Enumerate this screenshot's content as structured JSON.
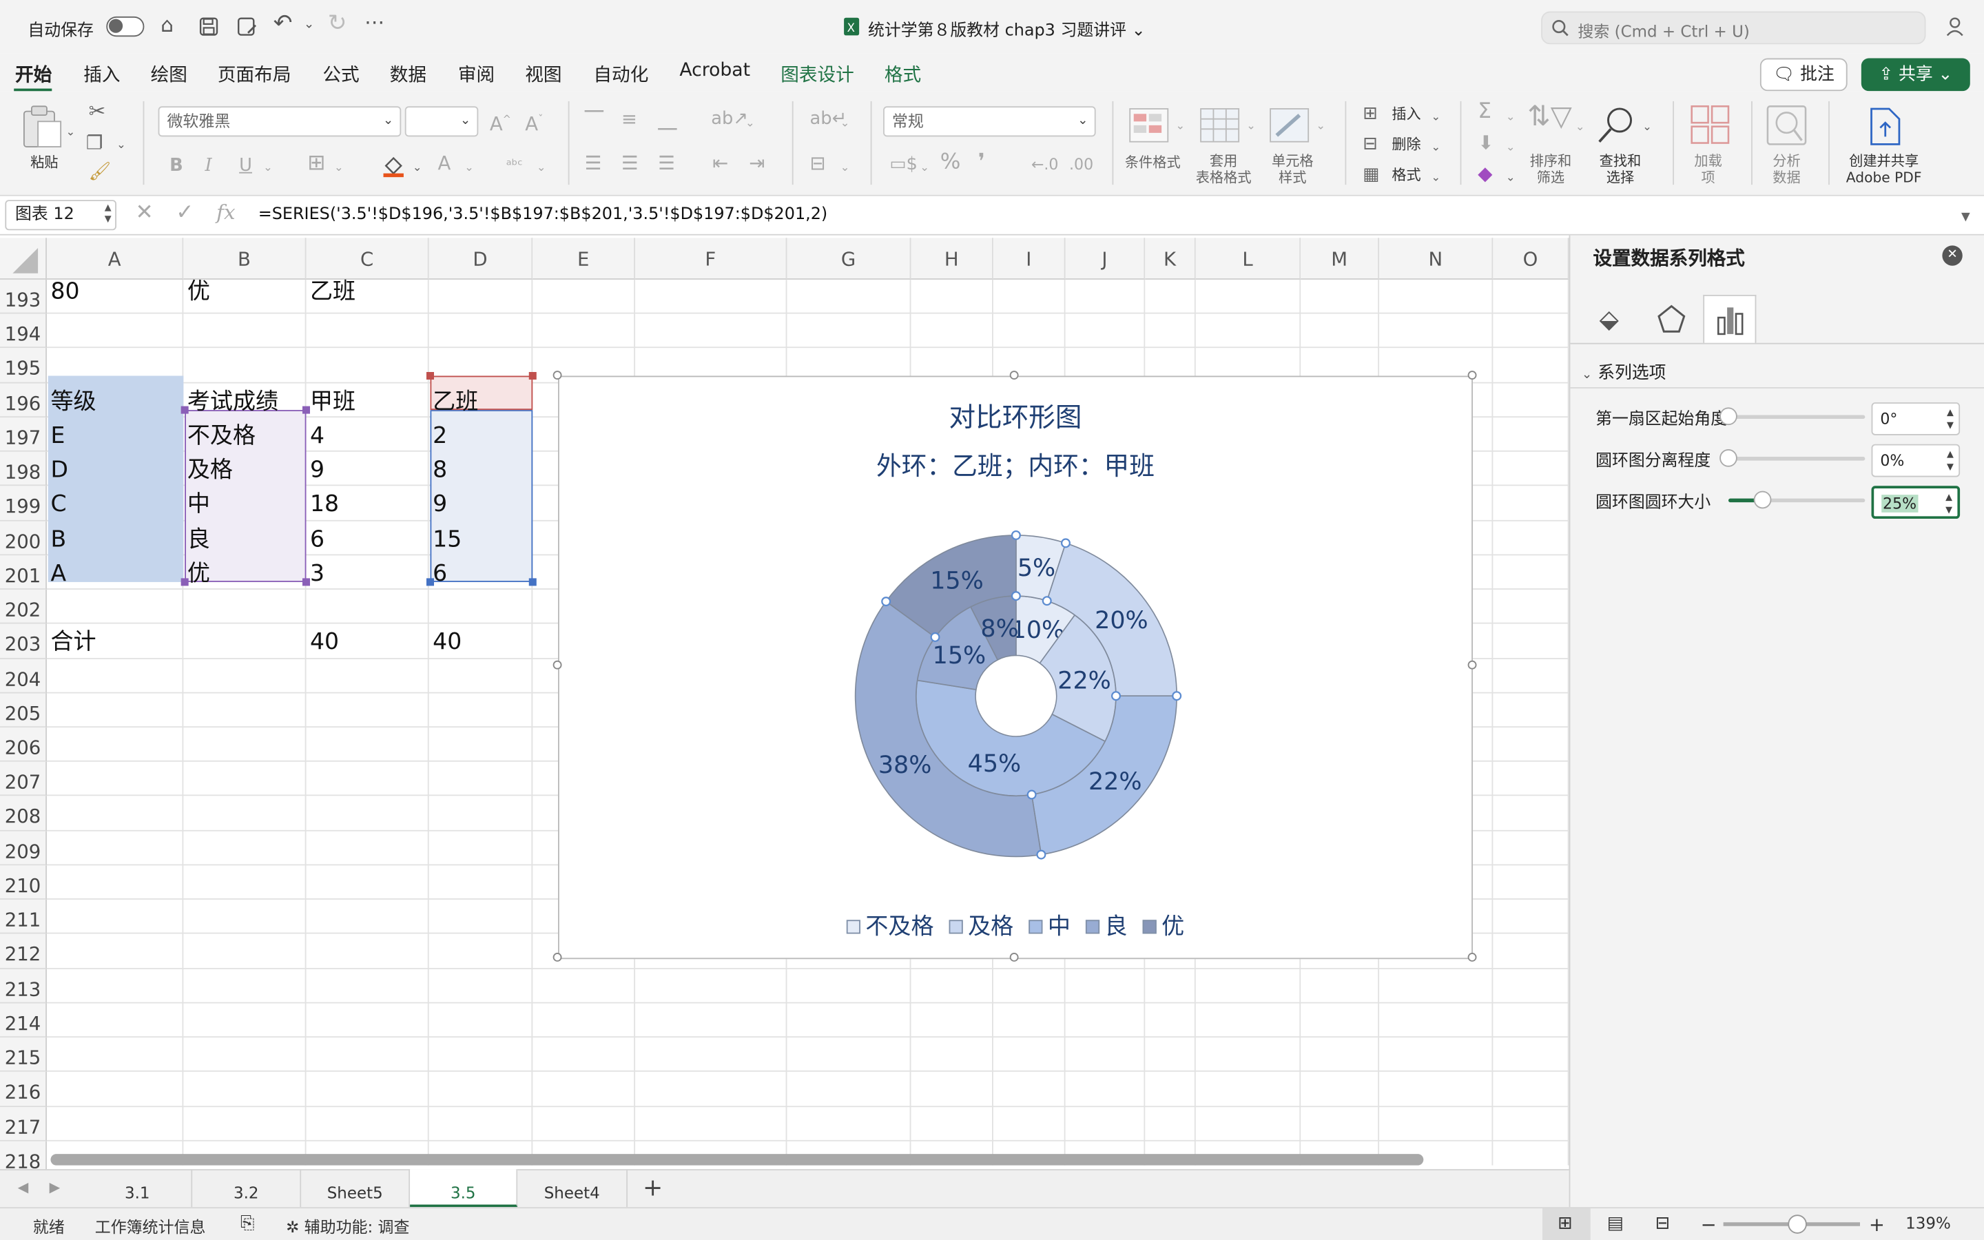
{
  "titlebar": {
    "autosave_label": "自动保存",
    "doc_title": "统计学第８版教材 chap3 习题讲评",
    "doc_title_chevron": "⌄",
    "search_placeholder": "搜索 (Cmd + Ctrl + U)"
  },
  "menu": {
    "items": [
      "开始",
      "插入",
      "绘图",
      "页面布局",
      "公式",
      "数据",
      "审阅",
      "视图",
      "自动化",
      "Acrobat",
      "图表设计",
      "格式"
    ],
    "comment_label": "批注",
    "share_label": "共享"
  },
  "ribbon": {
    "paste_label": "粘贴",
    "font_name": "微软雅黑",
    "font_size": "",
    "number_format": "常规",
    "bold": "B",
    "italic": "I",
    "underline": "U",
    "conditional_format_label": "条件格式",
    "table_format_label": "套用\n表格格式",
    "cell_style_label": "单元格\n样式",
    "insert_label": "插入",
    "delete_label": "删除",
    "format_label": "格式",
    "sort_filter_label": "排序和\n筛选",
    "find_select_label": "查找和\n选择",
    "addins_label": "加载\n项",
    "analyze_label": "分析\n数据",
    "adobe_label": "创建并共享\nAdobe PDF"
  },
  "formula_bar": {
    "name_box": "图表 12",
    "fx": "fx",
    "formula": "=SERIES('3.5'!$D$196,'3.5'!$B$197:$B$201,'3.5'!$D$197:$D$201,2)"
  },
  "grid": {
    "columns": [
      "A",
      "B",
      "C",
      "D",
      "E",
      "F",
      "G",
      "H",
      "I",
      "J",
      "K",
      "L",
      "M",
      "N",
      "O"
    ],
    "rows": [
      "193",
      "194",
      "195",
      "196",
      "197",
      "198",
      "199",
      "200",
      "201",
      "202",
      "203",
      "204",
      "205",
      "206",
      "207",
      "208",
      "209",
      "210",
      "211",
      "212",
      "213",
      "214",
      "215",
      "216",
      "217",
      "218"
    ],
    "cells": {
      "A193": "80",
      "B193": "优",
      "C193": "乙班",
      "A196": "等级",
      "B196": "考试成绩",
      "C196": "甲班",
      "D196": "乙班",
      "A197": "E",
      "B197": "不及格",
      "C197": "4",
      "D197": "2",
      "A198": "D",
      "B198": "及格",
      "C198": "9",
      "D198": "8",
      "A199": "C",
      "B199": "中",
      "C199": "18",
      "D199": "9",
      "A200": "B",
      "B200": "良",
      "C200": "6",
      "D200": "15",
      "A201": "A",
      "B201": "优",
      "C201": "3",
      "D201": "6",
      "A203": "合计",
      "C203": "40",
      "D203": "40"
    }
  },
  "chart_data": {
    "type": "doughnut",
    "title": "对比环形图",
    "subtitle": "外环：乙班；内环：甲班",
    "categories": [
      "不及格",
      "及格",
      "中",
      "良",
      "优"
    ],
    "colors": [
      "#e4ebf7",
      "#c9d7f0",
      "#a8bfe6",
      "#98acd3",
      "#8796b8"
    ],
    "series": [
      {
        "name": "甲班",
        "values": [
          4,
          9,
          18,
          6,
          3
        ],
        "labels": [
          "10%",
          "22%",
          "45%",
          "15%",
          "8%"
        ]
      },
      {
        "name": "乙班",
        "values": [
          2,
          8,
          9,
          15,
          6
        ],
        "labels": [
          "5%",
          "20%",
          "22%",
          "38%",
          "15%"
        ]
      }
    ],
    "legend": "bottom"
  },
  "pane": {
    "title": "设置数据系列格式",
    "section": "系列选项",
    "options": [
      {
        "label": "第一扇区起始角度",
        "value": "0°",
        "level": 0
      },
      {
        "label": "圆环图分离程度",
        "value": "0%",
        "level": 0
      },
      {
        "label": "圆环图圆环大小",
        "value": "25%",
        "level": 0.25
      }
    ]
  },
  "sheet_tabs": {
    "tabs": [
      "3.1",
      "3.2",
      "Sheet5",
      "3.5",
      "Sheet4"
    ],
    "active": "3.5",
    "add": "+"
  },
  "status": {
    "ready": "就绪",
    "workbook_stats": "工作簿统计信息",
    "accessibility": "辅助功能: 调查",
    "zoom": "139%"
  }
}
